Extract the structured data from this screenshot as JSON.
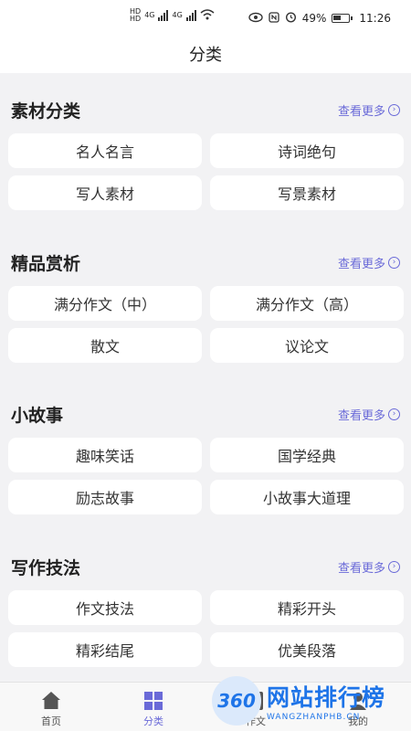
{
  "status": {
    "battery": "49%",
    "time": "11:26",
    "net1": "4G",
    "net2": "4G"
  },
  "header": {
    "title": "分类"
  },
  "more_label": "查看更多",
  "sections": [
    {
      "title": "素材分类",
      "items": [
        "名人名言",
        "诗词绝句",
        "写人素材",
        "写景素材"
      ]
    },
    {
      "title": "精品赏析",
      "items": [
        "满分作文（中）",
        "满分作文（高）",
        "散文",
        "议论文"
      ]
    },
    {
      "title": "小故事",
      "items": [
        "趣味笑话",
        "国学经典",
        "励志故事",
        "小故事大道理"
      ]
    },
    {
      "title": "写作技法",
      "items": [
        "作文技法",
        "精彩开头",
        "精彩结尾",
        "优美段落"
      ]
    }
  ],
  "tabs": [
    {
      "label": "首页",
      "icon": "home-icon",
      "active": false
    },
    {
      "label": "分类",
      "icon": "grid-icon",
      "active": true
    },
    {
      "label": "作文",
      "icon": "document-icon",
      "active": false
    },
    {
      "label": "我的",
      "icon": "user-icon",
      "active": false
    }
  ],
  "watermark": {
    "logo": "360",
    "cn": "网站排行榜",
    "en": "WANGZHANPHB.CN"
  },
  "colors": {
    "accent": "#6a6ad8",
    "background": "#f2f2f4",
    "card": "#ffffff"
  }
}
